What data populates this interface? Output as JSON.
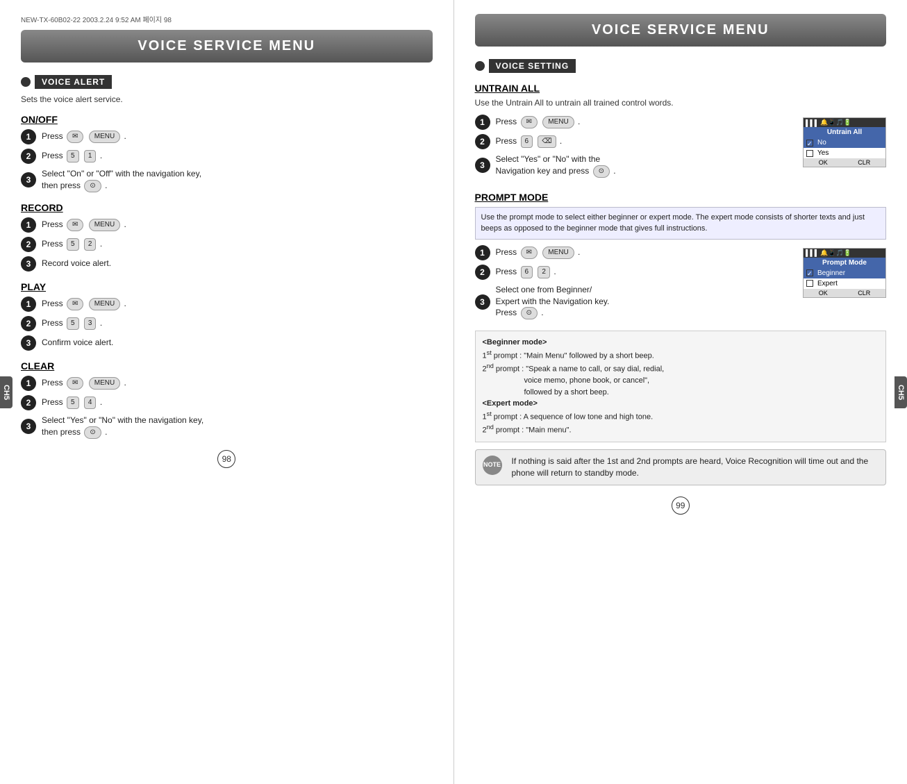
{
  "left_panel": {
    "header": "VOICE SERVICE MENU",
    "doc_header": "NEW-TX-60B02-22  2003.2.24 9:52 AM  페이지 98",
    "section_tag": "VOICE ALERT",
    "section_desc": "Sets the voice alert service.",
    "on_off": {
      "heading": "ON/OFF",
      "steps": [
        {
          "num": "1",
          "text": "Press",
          "buttons": [
            "envelope",
            "menu"
          ]
        },
        {
          "num": "2",
          "text": "Press",
          "buttons": [
            "5",
            "1"
          ]
        },
        {
          "num": "3",
          "text": "Select \"On\" or \"Off\" with the navigation key, then press",
          "buttons": [
            "ok"
          ]
        }
      ]
    },
    "record": {
      "heading": "RECORD",
      "steps": [
        {
          "num": "1",
          "text": "Press",
          "buttons": [
            "envelope",
            "menu"
          ]
        },
        {
          "num": "2",
          "text": "Press",
          "buttons": [
            "5",
            "2"
          ]
        },
        {
          "num": "3",
          "text": "Record voice alert."
        }
      ]
    },
    "play": {
      "heading": "PLAY",
      "steps": [
        {
          "num": "1",
          "text": "Press",
          "buttons": [
            "envelope",
            "menu"
          ]
        },
        {
          "num": "2",
          "text": "Press",
          "buttons": [
            "5",
            "3"
          ]
        },
        {
          "num": "3",
          "text": "Confirm voice alert."
        }
      ]
    },
    "clear": {
      "heading": "CLEAR",
      "steps": [
        {
          "num": "1",
          "text": "Press",
          "buttons": [
            "envelope",
            "menu"
          ]
        },
        {
          "num": "2",
          "text": "Press",
          "buttons": [
            "5",
            "4"
          ]
        },
        {
          "num": "3",
          "text": "Select \"Yes\" or \"No\" with the navigation key, then press",
          "buttons": [
            "ok"
          ]
        }
      ]
    },
    "page_num": "98",
    "ch_tab": "CH5"
  },
  "right_panel": {
    "header": "VOICE SERVICE MENU",
    "section_tag": "VOICE SETTING",
    "untrain_all": {
      "heading": "UNTRAIN ALL",
      "desc": "Use the Untrain All to untrain all trained control words.",
      "steps": [
        {
          "num": "1",
          "text": "Press",
          "buttons": [
            "envelope",
            "menu"
          ]
        },
        {
          "num": "2",
          "text": "Press",
          "buttons": [
            "6",
            "back"
          ]
        },
        {
          "num": "3",
          "text": "Select \"Yes\" or \"No\" with the Navigation key  and press",
          "buttons": [
            "ok"
          ]
        }
      ],
      "screen": {
        "signal": "▌▌▌ 🔔 📱 🎵 🔋",
        "title": "Untrain All",
        "items": [
          {
            "label": "✓ No",
            "selected": true
          },
          {
            "label": "□ Yes",
            "selected": false
          }
        ],
        "footer": [
          "OK",
          "CLR"
        ]
      }
    },
    "prompt_mode": {
      "heading": "PROMPT MODE",
      "desc": "Use the prompt mode to select either beginner or expert mode. The expert mode consists of shorter texts and just beeps as opposed to the beginner mode that gives full instructions.",
      "steps": [
        {
          "num": "1",
          "text": "Press",
          "buttons": [
            "envelope",
            "menu"
          ]
        },
        {
          "num": "2",
          "text": "Press",
          "buttons": [
            "6",
            "2"
          ]
        },
        {
          "num": "3",
          "text": "Select one from Beginner/\nExpert with the Navigation key.\nPress",
          "buttons": [
            "ok"
          ]
        }
      ],
      "screen": {
        "title": "Prompt Mode",
        "items": [
          {
            "label": "✓ Beginner",
            "selected": true
          },
          {
            "label": "□ Expert",
            "selected": false
          }
        ],
        "footer": [
          "OK",
          "CLR"
        ]
      },
      "beginner_mode": {
        "title": "<Beginner mode>",
        "lines": [
          "1st prompt : \"Main Menu\" followed by a short beep.",
          "2nd prompt : \"Speak a name to call, or say dial, redial,",
          "                    voice memo, phone book, or cancel\",",
          "                    followed by a short beep."
        ]
      },
      "expert_mode": {
        "title": "<Expert mode>",
        "lines": [
          "1st prompt : A sequence of low tone and high tone.",
          "2nd prompt : \"Main menu\"."
        ]
      }
    },
    "note": "If nothing is said after the 1st and 2nd prompts are heard, Voice Recognition will time out and the phone will return to standby mode.",
    "page_num": "99",
    "ch_tab": "CH5"
  }
}
